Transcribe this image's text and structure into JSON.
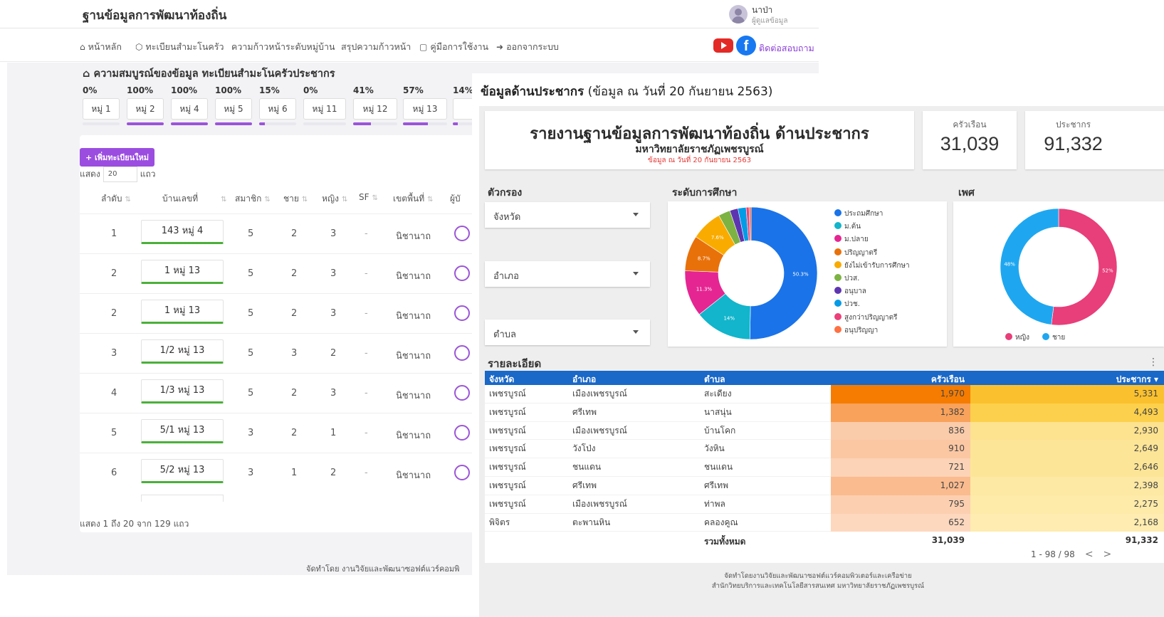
{
  "back": {
    "brand": "ฐานข้อมูลการพัฒนาท้องถิ่น",
    "user": {
      "name": "นาป่า",
      "role": "ผู้ดูแลข้อมูล"
    },
    "nav": [
      {
        "label": "หน้าหลัก",
        "icon": "home-icon",
        "glyph": "⌂"
      },
      {
        "label": "ทะเบียนสำมะโนครัว",
        "icon": "cube-icon",
        "glyph": "⬡"
      },
      {
        "label": "ความก้าวหน้าระดับหมู่บ้าน",
        "icon": "",
        "glyph": ""
      },
      {
        "label": "สรุปความก้าวหน้า",
        "icon": "",
        "glyph": ""
      },
      {
        "label": "คู่มือการใช้งาน",
        "icon": "book-icon",
        "glyph": "▢"
      },
      {
        "label": "ออกจากระบบ",
        "icon": "logout-icon",
        "glyph": "➜"
      }
    ],
    "contact_label": "ติดต่อสอบถาม",
    "section_title": "ความสมบูรณ์ของข้อมูล ทะเบียนสำมะโนครัวประชากร",
    "villages": [
      {
        "pct": "0%",
        "name": "หมู่ 1",
        "fill": 0
      },
      {
        "pct": "100%",
        "name": "หมู่ 2",
        "fill": 100
      },
      {
        "pct": "100%",
        "name": "หมู่ 4",
        "fill": 100
      },
      {
        "pct": "100%",
        "name": "หมู่ 5",
        "fill": 100
      },
      {
        "pct": "15%",
        "name": "หมู่ 6",
        "fill": 15
      },
      {
        "pct": "0%",
        "name": "หมู่ 11",
        "fill": 0
      },
      {
        "pct": "41%",
        "name": "หมู่ 12",
        "fill": 41
      },
      {
        "pct": "57%",
        "name": "หมู่ 13",
        "fill": 57
      },
      {
        "pct": "14%",
        "name": "",
        "fill": 14
      }
    ],
    "add_button": "+ เพิ่มทะเบียนใหม่",
    "show_prefix": "แสดง",
    "show_value": "20",
    "show_suffix": "แถว",
    "headers": {
      "no": "ลำดับ",
      "house": "บ้านเลขที่",
      "members": "สมาชิก",
      "male": "ชาย",
      "female": "หญิง",
      "sf": "SF",
      "zone": "เขตพื้นที่",
      "author": "ผู้บั"
    },
    "rows": [
      {
        "no": "1",
        "house": "143 หมู่ 4",
        "members": "5",
        "male": "2",
        "female": "3",
        "sf": "-",
        "zone": "นิชานาถ"
      },
      {
        "no": "2",
        "house": "1 หมู่ 13",
        "members": "5",
        "male": "2",
        "female": "3",
        "sf": "-",
        "zone": "นิชานาถ"
      },
      {
        "no": "2",
        "house": "1 หมู่ 13",
        "members": "5",
        "male": "2",
        "female": "3",
        "sf": "-",
        "zone": "นิชานาถ"
      },
      {
        "no": "3",
        "house": "1/2 หมู่ 13",
        "members": "5",
        "male": "3",
        "female": "2",
        "sf": "-",
        "zone": "นิชานาถ"
      },
      {
        "no": "4",
        "house": "1/3 หมู่ 13",
        "members": "5",
        "male": "2",
        "female": "3",
        "sf": "-",
        "zone": "นิชานาถ"
      },
      {
        "no": "5",
        "house": "5/1 หมู่ 13",
        "members": "3",
        "male": "2",
        "female": "1",
        "sf": "-",
        "zone": "นิชานาถ"
      },
      {
        "no": "6",
        "house": "5/2 หมู่ 13",
        "members": "3",
        "male": "1",
        "female": "2",
        "sf": "-",
        "zone": "นิชานาถ"
      }
    ],
    "footer_note": "แสดง 1 ถึง 20 จาก 129 แถว",
    "credit": "จัดทำโดย งานวิจัยและพัฒนาซอฟต์แวร์คอมพิ"
  },
  "front": {
    "title_bold": "ข้อมูลด้านประชากร",
    "title_rest": " (ข้อมูล ณ วันที่ 20 กันยายน 2563)",
    "report_title": "รายงานฐานข้อมูลการพัฒนาท้องถิ่น ด้านประชากร",
    "report_sub": "มหาวิทยาลัยราชภัฏเพชรบูรณ์",
    "report_date": "ข้อมูล ณ วันที่ 20 กันยายน 2563",
    "stats": [
      {
        "label": "ครัวเรือน",
        "value": "31,039"
      },
      {
        "label": "ประชากร",
        "value": "91,332"
      }
    ],
    "filter_title": "ตัวกรอง",
    "filters": [
      "จังหวัด",
      "อำเภอ",
      "ตำบล"
    ],
    "edu_title": "ระดับการศึกษา",
    "sex_title": "เพศ",
    "detail_title": "รายละเอียด",
    "table_headers": {
      "prov": "จังหวัด",
      "amp": "อำเภอ",
      "tam": "ตำบล",
      "hh": "ครัวเรือน",
      "pop": "ประชากร ▾"
    },
    "table_rows": [
      {
        "prov": "เพชรบูรณ์",
        "amp": "เมืองเพชรบูรณ์",
        "tam": "สะเดียง",
        "hh": "1,970",
        "pop": "5,331",
        "hh_color": "#f57c00",
        "pop_color": "#fbc02d"
      },
      {
        "prov": "เพชรบูรณ์",
        "amp": "ศรีเทพ",
        "tam": "นาสนุ่น",
        "hh": "1,382",
        "pop": "4,493",
        "hh_color": "#f8a25b",
        "pop_color": "#fcd04c"
      },
      {
        "prov": "เพชรบูรณ์",
        "amp": "เมืองเพชรบูรณ์",
        "tam": "บ้านโคก",
        "hh": "836",
        "pop": "2,930",
        "hh_color": "#fbccaa",
        "pop_color": "#fde28f"
      },
      {
        "prov": "เพชรบูรณ์",
        "amp": "วังโป่ง",
        "tam": "วังหิน",
        "hh": "910",
        "pop": "2,649",
        "hh_color": "#fbc7a3",
        "pop_color": "#fde597"
      },
      {
        "prov": "เพชรบูรณ์",
        "amp": "ชนแดน",
        "tam": "ชนแดน",
        "hh": "721",
        "pop": "2,646",
        "hh_color": "#fcd3b6",
        "pop_color": "#fde597"
      },
      {
        "prov": "เพชรบูรณ์",
        "amp": "ศรีเทพ",
        "tam": "ศรีเทพ",
        "hh": "1,027",
        "pop": "2,398",
        "hh_color": "#fabb8f",
        "pop_color": "#fde9a4"
      },
      {
        "prov": "เพชรบูรณ์",
        "amp": "เมืองเพชรบูรณ์",
        "tam": "ท่าพล",
        "hh": "795",
        "pop": "2,275",
        "hh_color": "#fccfb0",
        "pop_color": "#feeaa9"
      },
      {
        "prov": "พิจิตร",
        "amp": "ตะพานหิน",
        "tam": "คลองคูณ",
        "hh": "652",
        "pop": "2,168",
        "hh_color": "#fdd8be",
        "pop_color": "#feecb0"
      }
    ],
    "total_label": "รวมทั้งหมด",
    "total_hh": "31,039",
    "total_pop": "91,332",
    "pager": "1 - 98 / 98",
    "credit_1": "จัดทำโดยงานวิจัยและพัฒนาซอฟต์แวร์คอมพิวเตอร์และเครือข่าย",
    "credit_2": "สำนักวิทยบริการและเทคโนโลยีสารสนเทศ มหาวิทยาลัยราชภัฏเพชรบูรณ์"
  },
  "chart_data": [
    {
      "type": "pie",
      "title": "ระดับการศึกษา",
      "categories": [
        "ประถมศึกษา",
        "ม.ต้น",
        "ม.ปลาย",
        "ปริญญาตรี",
        "ยังไม่เข้ารับการศึกษา",
        "ปวส.",
        "อนุบาล",
        "ปวช.",
        "สูงกว่าปริญญาตรี",
        "อนุปริญญา"
      ],
      "values": [
        50.3,
        14,
        11.3,
        8.7,
        7.6,
        2.9,
        2.0,
        2.0,
        0.7,
        0.5
      ],
      "colors": [
        "#1a73e8",
        "#12b5cb",
        "#e52592",
        "#e8710a",
        "#f9ab00",
        "#7cb342",
        "#5e35b1",
        "#039be5",
        "#ec407a",
        "#ff7043"
      ],
      "labels_shown": [
        "50.3%",
        "14%",
        "11.3%",
        "8.7%",
        "7.6%"
      ],
      "legend_position": "right"
    },
    {
      "type": "pie",
      "title": "เพศ",
      "categories": [
        "หญิง",
        "ชาย"
      ],
      "values": [
        52,
        48
      ],
      "colors": [
        "#e83e7a",
        "#1ea7f0"
      ],
      "labels_shown": [
        "52%",
        "48%"
      ],
      "legend_position": "bottom"
    }
  ]
}
